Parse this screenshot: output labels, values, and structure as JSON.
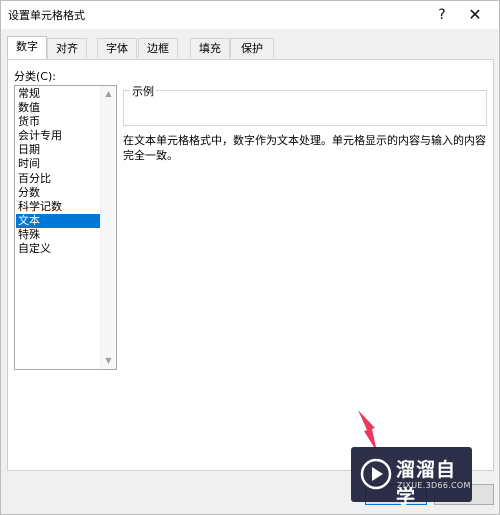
{
  "window": {
    "title": "设置单元格格式",
    "help_icon": "?",
    "close_icon": "✕"
  },
  "tabs": [
    {
      "label": "数字",
      "active": true
    },
    {
      "label": "对齐",
      "active": false
    },
    {
      "label": "字体",
      "active": false
    },
    {
      "label": "边框",
      "active": false
    },
    {
      "label": "填充",
      "active": false
    },
    {
      "label": "保护",
      "active": false
    }
  ],
  "category": {
    "label": "分类(C):",
    "items": [
      "常规",
      "数值",
      "货币",
      "会计专用",
      "日期",
      "时间",
      "百分比",
      "分数",
      "科学记数",
      "文本",
      "特殊",
      "自定义"
    ],
    "selected": "文本"
  },
  "sample": {
    "legend": "示例",
    "value": ""
  },
  "description": "在文本单元格格式中，数字作为文本处理。单元格显示的内容与输入的内容完全一致。",
  "buttons": {
    "ok": "",
    "cancel": ""
  },
  "watermark": {
    "name": "溜溜自学",
    "url": "ZIXUE.3D66.COM"
  },
  "colors": {
    "selection": "#0078d7",
    "arrow": "#e83a5a",
    "watermark_bg": "#1c1e3a"
  }
}
